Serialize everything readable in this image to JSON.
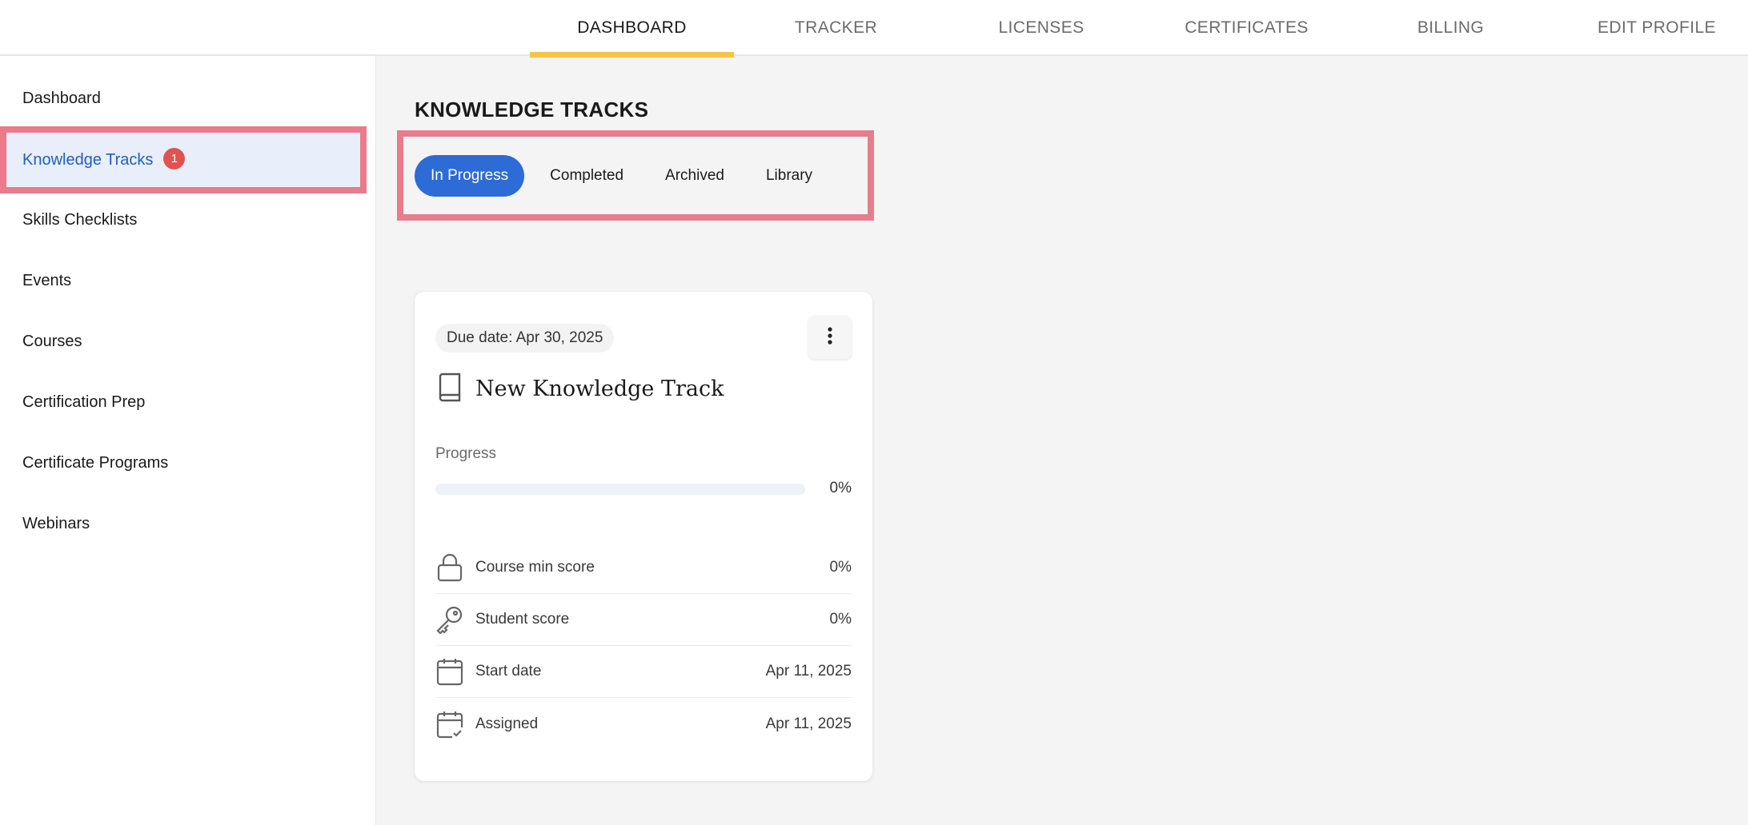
{
  "topnav": {
    "tabs": [
      "DASHBOARD",
      "TRACKER",
      "LICENSES",
      "CERTIFICATES",
      "BILLING",
      "EDIT PROFILE"
    ],
    "active": "DASHBOARD",
    "accent_color": "#f2c642"
  },
  "sidebar": {
    "items": [
      {
        "label": "Dashboard"
      },
      {
        "label": "Knowledge Tracks",
        "badge": "1",
        "active": true
      },
      {
        "label": "Skills Checklists"
      },
      {
        "label": "Events"
      },
      {
        "label": "Courses"
      },
      {
        "label": "Certification Prep"
      },
      {
        "label": "Certificate Programs"
      },
      {
        "label": "Webinars"
      }
    ],
    "active_color": "#1f5fbf",
    "badge_color": "#e0534f"
  },
  "main": {
    "title": "KNOWLEDGE TRACKS",
    "subtabs": [
      "In Progress",
      "Completed",
      "Archived",
      "Library"
    ],
    "active_subtab": "In Progress",
    "card": {
      "due_date": "Due date: Apr 30, 2025",
      "title": "New Knowledge Track",
      "progress_label": "Progress",
      "progress_value": 0,
      "progress_text": "0%",
      "rows": [
        {
          "icon": "lock-icon",
          "label": "Course min score",
          "value": "0%"
        },
        {
          "icon": "key-icon",
          "label": "Student score",
          "value": "0%"
        },
        {
          "icon": "calendar-icon",
          "label": "Start date",
          "value": "Apr 11, 2025"
        },
        {
          "icon": "calendar-check-icon",
          "label": "Assigned",
          "value": "Apr 11, 2025"
        }
      ]
    }
  },
  "colors": {
    "primary": "#2d6bd6",
    "highlight_border": "#e97b8c"
  }
}
